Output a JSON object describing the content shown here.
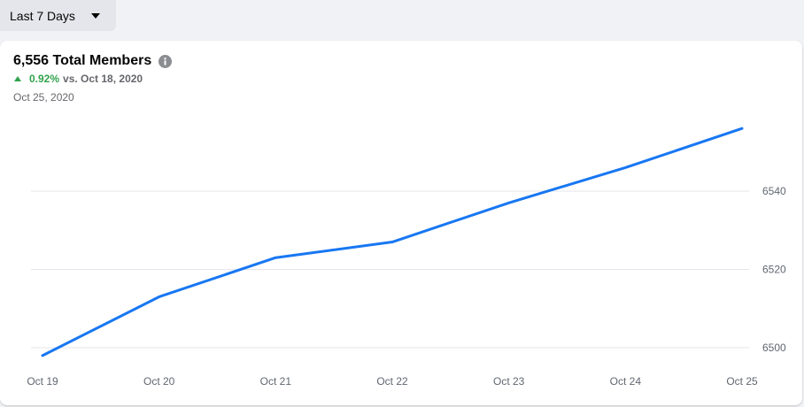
{
  "filter": {
    "label": "Last 7 Days",
    "icon": "caret-down-icon"
  },
  "summary": {
    "title": "6,556 Total Members",
    "change_pct": "0.92%",
    "change_vs": "vs. Oct 18, 2020",
    "date": "Oct 25, 2020",
    "info_icon": "info-icon"
  },
  "colors": {
    "line": "#1877f2",
    "positive": "#31a24c",
    "grid": "#e4e6eb"
  },
  "chart_data": {
    "type": "line",
    "categories": [
      "Oct 19",
      "Oct 20",
      "Oct 21",
      "Oct 22",
      "Oct 23",
      "Oct 24",
      "Oct 25"
    ],
    "values": [
      6498,
      6513,
      6523,
      6527,
      6537,
      6546,
      6556
    ],
    "yticks": [
      6500,
      6520,
      6540
    ],
    "ylim": [
      6500,
      6556
    ],
    "grid": true,
    "y_axis_side": "right"
  }
}
